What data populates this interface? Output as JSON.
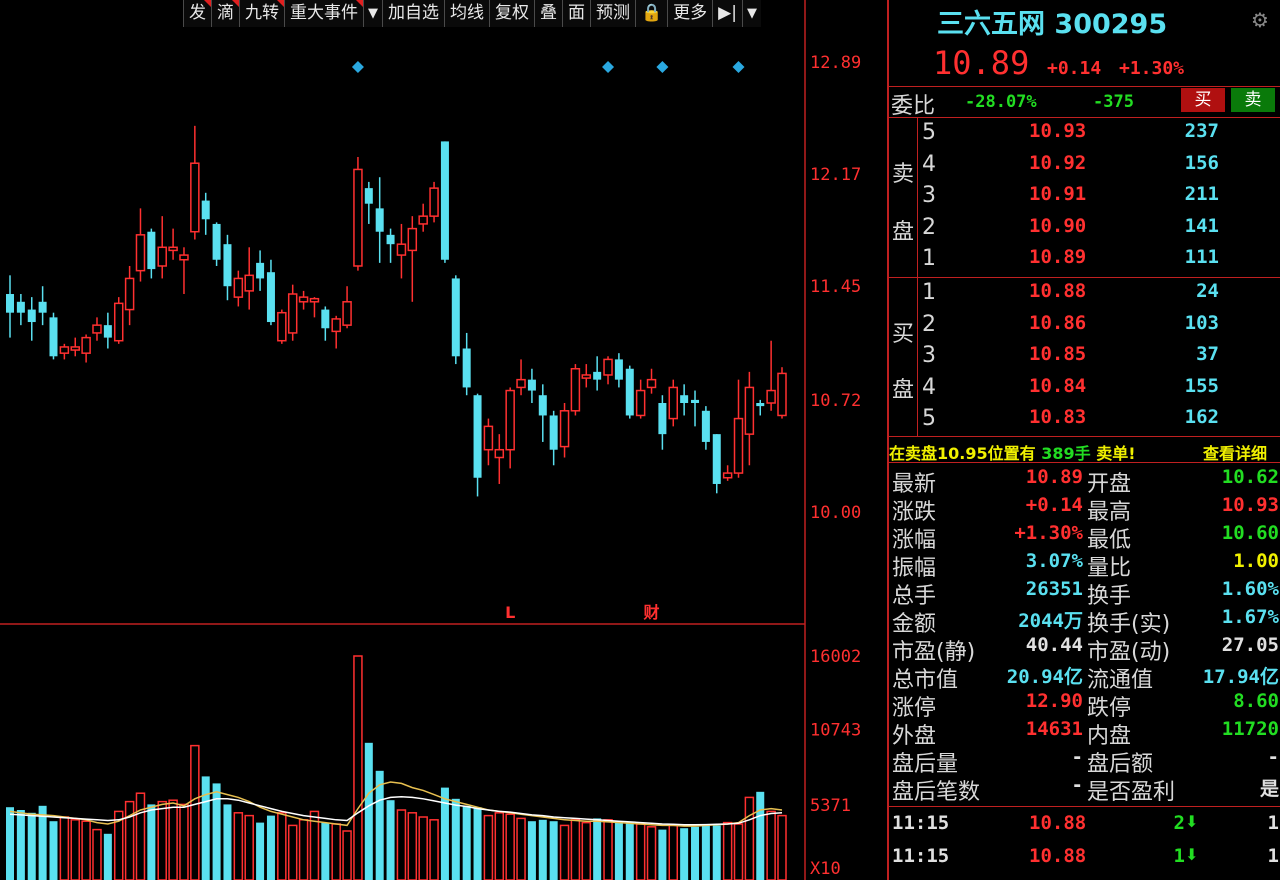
{
  "toolbar": {
    "items": [
      "发",
      "滴",
      "九转",
      "重大事件",
      "▼",
      "加自选",
      "均线",
      "复权",
      "叠",
      "面",
      "预测",
      "🔒",
      "更多",
      "▶|",
      "▼"
    ],
    "flagged": [
      0,
      1,
      2,
      3
    ]
  },
  "chart_data": [
    {
      "type": "candlestick",
      "price_ticks": [
        "12.89",
        "12.17",
        "11.45",
        "10.72",
        "10.00"
      ],
      "ylim": [
        10.0,
        12.89
      ],
      "markers_bottom": [
        "L",
        "财"
      ],
      "candles": [
        {
          "o": 11.4,
          "c": 11.28,
          "h": 11.52,
          "l": 11.12,
          "up": false
        },
        {
          "o": 11.35,
          "c": 11.28,
          "h": 11.4,
          "l": 11.2,
          "up": false
        },
        {
          "o": 11.3,
          "c": 11.22,
          "h": 11.38,
          "l": 11.1,
          "up": false
        },
        {
          "o": 11.35,
          "c": 11.28,
          "h": 11.45,
          "l": 11.2,
          "up": false
        },
        {
          "o": 11.25,
          "c": 11.0,
          "h": 11.28,
          "l": 10.98,
          "up": false
        },
        {
          "o": 11.02,
          "c": 11.06,
          "h": 11.08,
          "l": 10.98,
          "up": true
        },
        {
          "o": 11.04,
          "c": 11.06,
          "h": 11.12,
          "l": 11.0,
          "up": true
        },
        {
          "o": 11.02,
          "c": 11.12,
          "h": 11.14,
          "l": 10.96,
          "up": true
        },
        {
          "o": 11.15,
          "c": 11.2,
          "h": 11.25,
          "l": 11.1,
          "up": true
        },
        {
          "o": 11.2,
          "c": 11.12,
          "h": 11.28,
          "l": 11.05,
          "up": false
        },
        {
          "o": 11.1,
          "c": 11.34,
          "h": 11.38,
          "l": 11.08,
          "up": true
        },
        {
          "o": 11.3,
          "c": 11.5,
          "h": 11.58,
          "l": 11.2,
          "up": true
        },
        {
          "o": 11.55,
          "c": 11.78,
          "h": 11.95,
          "l": 11.48,
          "up": true
        },
        {
          "o": 11.8,
          "c": 11.56,
          "h": 11.82,
          "l": 11.5,
          "up": false
        },
        {
          "o": 11.58,
          "c": 11.7,
          "h": 11.9,
          "l": 11.5,
          "up": true
        },
        {
          "o": 11.68,
          "c": 11.7,
          "h": 11.82,
          "l": 11.62,
          "up": true
        },
        {
          "o": 11.62,
          "c": 11.65,
          "h": 11.7,
          "l": 11.4,
          "up": true
        },
        {
          "o": 11.8,
          "c": 12.24,
          "h": 12.48,
          "l": 11.75,
          "up": true
        },
        {
          "o": 12.0,
          "c": 11.88,
          "h": 12.05,
          "l": 11.78,
          "up": false
        },
        {
          "o": 11.85,
          "c": 11.62,
          "h": 11.86,
          "l": 11.58,
          "up": false
        },
        {
          "o": 11.72,
          "c": 11.45,
          "h": 11.78,
          "l": 11.36,
          "up": false
        },
        {
          "o": 11.38,
          "c": 11.5,
          "h": 11.55,
          "l": 11.32,
          "up": true
        },
        {
          "o": 11.42,
          "c": 11.52,
          "h": 11.7,
          "l": 11.3,
          "up": true
        },
        {
          "o": 11.6,
          "c": 11.5,
          "h": 11.68,
          "l": 11.42,
          "up": false
        },
        {
          "o": 11.54,
          "c": 11.22,
          "h": 11.62,
          "l": 11.2,
          "up": false
        },
        {
          "o": 11.1,
          "c": 11.28,
          "h": 11.3,
          "l": 11.08,
          "up": true
        },
        {
          "o": 11.15,
          "c": 11.4,
          "h": 11.46,
          "l": 11.1,
          "up": true
        },
        {
          "o": 11.35,
          "c": 11.38,
          "h": 11.42,
          "l": 11.3,
          "up": true
        },
        {
          "o": 11.35,
          "c": 11.37,
          "h": 11.38,
          "l": 11.25,
          "up": true
        },
        {
          "o": 11.3,
          "c": 11.18,
          "h": 11.32,
          "l": 11.1,
          "up": false
        },
        {
          "o": 11.16,
          "c": 11.24,
          "h": 11.26,
          "l": 11.05,
          "up": true
        },
        {
          "o": 11.2,
          "c": 11.35,
          "h": 11.45,
          "l": 11.18,
          "up": true
        },
        {
          "o": 11.58,
          "c": 12.2,
          "h": 12.28,
          "l": 11.55,
          "up": true
        },
        {
          "o": 12.08,
          "c": 11.98,
          "h": 12.12,
          "l": 11.85,
          "up": false
        },
        {
          "o": 11.95,
          "c": 11.8,
          "h": 12.15,
          "l": 11.6,
          "up": false
        },
        {
          "o": 11.78,
          "c": 11.72,
          "h": 11.82,
          "l": 11.6,
          "up": false
        },
        {
          "o": 11.65,
          "c": 11.72,
          "h": 11.85,
          "l": 11.5,
          "up": true
        },
        {
          "o": 11.68,
          "c": 11.82,
          "h": 11.9,
          "l": 11.35,
          "up": true
        },
        {
          "o": 11.85,
          "c": 11.9,
          "h": 11.98,
          "l": 11.8,
          "up": true
        },
        {
          "o": 11.9,
          "c": 12.08,
          "h": 12.12,
          "l": 11.86,
          "up": true
        },
        {
          "o": 12.38,
          "c": 11.62,
          "h": 12.38,
          "l": 11.6,
          "up": false
        },
        {
          "o": 11.5,
          "c": 11.0,
          "h": 11.52,
          "l": 10.95,
          "up": false
        },
        {
          "o": 11.05,
          "c": 10.8,
          "h": 11.15,
          "l": 10.75,
          "up": false
        },
        {
          "o": 10.75,
          "c": 10.22,
          "h": 10.76,
          "l": 10.1,
          "up": false
        },
        {
          "o": 10.4,
          "c": 10.55,
          "h": 10.6,
          "l": 10.3,
          "up": true
        },
        {
          "o": 10.35,
          "c": 10.4,
          "h": 10.5,
          "l": 10.18,
          "up": true
        },
        {
          "o": 10.4,
          "c": 10.78,
          "h": 10.8,
          "l": 10.28,
          "up": true
        },
        {
          "o": 10.8,
          "c": 10.85,
          "h": 10.98,
          "l": 10.75,
          "up": true
        },
        {
          "o": 10.85,
          "c": 10.78,
          "h": 10.92,
          "l": 10.7,
          "up": false
        },
        {
          "o": 10.75,
          "c": 10.62,
          "h": 10.82,
          "l": 10.45,
          "up": false
        },
        {
          "o": 10.62,
          "c": 10.4,
          "h": 10.65,
          "l": 10.3,
          "up": false
        },
        {
          "o": 10.42,
          "c": 10.65,
          "h": 10.7,
          "l": 10.35,
          "up": true
        },
        {
          "o": 10.65,
          "c": 10.92,
          "h": 10.95,
          "l": 10.62,
          "up": true
        },
        {
          "o": 10.86,
          "c": 10.88,
          "h": 10.95,
          "l": 10.8,
          "up": true
        },
        {
          "o": 10.9,
          "c": 10.85,
          "h": 11.0,
          "l": 10.78,
          "up": false
        },
        {
          "o": 10.88,
          "c": 10.98,
          "h": 11.0,
          "l": 10.82,
          "up": true
        },
        {
          "o": 10.98,
          "c": 10.85,
          "h": 11.02,
          "l": 10.8,
          "up": false
        },
        {
          "o": 10.92,
          "c": 10.62,
          "h": 10.94,
          "l": 10.6,
          "up": false
        },
        {
          "o": 10.62,
          "c": 10.78,
          "h": 10.85,
          "l": 10.6,
          "up": true
        },
        {
          "o": 10.8,
          "c": 10.85,
          "h": 10.92,
          "l": 10.76,
          "up": true
        },
        {
          "o": 10.7,
          "c": 10.5,
          "h": 10.75,
          "l": 10.4,
          "up": false
        },
        {
          "o": 10.6,
          "c": 10.8,
          "h": 10.85,
          "l": 10.55,
          "up": true
        },
        {
          "o": 10.75,
          "c": 10.7,
          "h": 10.82,
          "l": 10.62,
          "up": false
        },
        {
          "o": 10.72,
          "c": 10.7,
          "h": 10.78,
          "l": 10.55,
          "up": false
        },
        {
          "o": 10.65,
          "c": 10.45,
          "h": 10.68,
          "l": 10.4,
          "up": false
        },
        {
          "o": 10.5,
          "c": 10.18,
          "h": 10.5,
          "l": 10.12,
          "up": false
        },
        {
          "o": 10.22,
          "c": 10.25,
          "h": 10.3,
          "l": 10.2,
          "up": true
        },
        {
          "o": 10.25,
          "c": 10.6,
          "h": 10.85,
          "l": 10.22,
          "up": true
        },
        {
          "o": 10.5,
          "c": 10.8,
          "h": 10.9,
          "l": 10.3,
          "up": true
        },
        {
          "o": 10.7,
          "c": 10.68,
          "h": 10.72,
          "l": 10.62,
          "up": false
        },
        {
          "o": 10.7,
          "c": 10.78,
          "h": 11.1,
          "l": 10.65,
          "up": true
        },
        {
          "o": 10.62,
          "c": 10.89,
          "h": 10.93,
          "l": 10.6,
          "up": true
        }
      ],
      "diamond_marker_indices": [
        32,
        55,
        60,
        67
      ]
    },
    {
      "type": "bar",
      "volume_ticks": [
        "16002",
        "10743",
        "5371",
        "X10"
      ],
      "ylim": [
        0,
        16002
      ],
      "volumes": [
        5200,
        5000,
        4800,
        5300,
        4200,
        4500,
        4300,
        4200,
        3600,
        3300,
        4900,
        5600,
        6200,
        5400,
        5600,
        5700,
        5400,
        9600,
        7400,
        6900,
        5400,
        4800,
        4600,
        4100,
        4600,
        4800,
        3900,
        4300,
        4900,
        4100,
        4000,
        3500,
        16002,
        9800,
        7800,
        5700,
        5000,
        4800,
        4500,
        4300,
        6600,
        5800,
        5300,
        5200,
        4600,
        4800,
        4700,
        4400,
        4200,
        4300,
        4200,
        3900,
        4300,
        4100,
        4400,
        4300,
        4200,
        4100,
        4000,
        3800,
        3600,
        3900,
        3700,
        3800,
        3900,
        3900,
        4100,
        4000,
        5900,
        6300,
        4900,
        4600
      ],
      "ma_lines": [
        {
          "color": "#e8c050",
          "values": [
            4900,
            4800,
            4700,
            4650,
            4600,
            4500,
            4400,
            4300,
            4100,
            4000,
            4200,
            4600,
            5000,
            5200,
            5400,
            5500,
            5300,
            5800,
            6100,
            6300,
            6100,
            5900,
            5600,
            5200,
            4900,
            4700,
            4500,
            4300,
            4200,
            4100,
            4000,
            3900,
            5100,
            6200,
            6800,
            7000,
            6900,
            6600,
            6400,
            6100,
            5800,
            5600,
            5400,
            5200,
            5000,
            4900,
            4800,
            4700,
            4600,
            4500,
            4400,
            4300,
            4250,
            4200,
            4200,
            4150,
            4100,
            4050,
            4000,
            3950,
            3900,
            3900,
            3850,
            3850,
            3900,
            3950,
            4000,
            4100,
            4600,
            5000,
            5100,
            5000
          ]
        },
        {
          "color": "#ffffff",
          "values": [
            4700,
            4650,
            4600,
            4550,
            4500,
            4450,
            4400,
            4350,
            4300,
            4250,
            4300,
            4500,
            4800,
            5000,
            5100,
            5200,
            5200,
            5400,
            5600,
            5800,
            5800,
            5700,
            5500,
            5300,
            5100,
            4900,
            4750,
            4600,
            4500,
            4400,
            4300,
            4250,
            4800,
            5300,
            5700,
            5900,
            5950,
            5900,
            5800,
            5650,
            5500,
            5350,
            5250,
            5100,
            5000,
            4900,
            4850,
            4750,
            4650,
            4600,
            4500,
            4450,
            4400,
            4350,
            4300,
            4250,
            4200,
            4150,
            4100,
            4050,
            4000,
            3980,
            3950,
            3950,
            3960,
            3980,
            4000,
            4050,
            4300,
            4600,
            4750,
            4800
          ]
        }
      ]
    }
  ],
  "panel": {
    "stock_name": "三六五网",
    "stock_code": "300295",
    "price": "10.89",
    "change": "+0.14",
    "change_pct": "+1.30%",
    "ratio_label": "委比",
    "ratio_pct": "-28.07%",
    "ratio_val": "-375",
    "buy_btn": "买",
    "sell_btn": "卖",
    "sell_side_label": [
      "卖",
      "盘"
    ],
    "buy_side_label": [
      "买",
      "盘"
    ],
    "sell_levels": [
      {
        "n": "5",
        "p": "10.93",
        "v": "237"
      },
      {
        "n": "4",
        "p": "10.92",
        "v": "156"
      },
      {
        "n": "3",
        "p": "10.91",
        "v": "211"
      },
      {
        "n": "2",
        "p": "10.90",
        "v": "141"
      },
      {
        "n": "1",
        "p": "10.89",
        "v": "111"
      }
    ],
    "buy_levels": [
      {
        "n": "1",
        "p": "10.88",
        "v": "24"
      },
      {
        "n": "2",
        "p": "10.86",
        "v": "103"
      },
      {
        "n": "3",
        "p": "10.85",
        "v": "37"
      },
      {
        "n": "4",
        "p": "10.84",
        "v": "155"
      },
      {
        "n": "5",
        "p": "10.83",
        "v": "162"
      }
    ],
    "notice_a": "在卖盘10.95位置有",
    "notice_b": "389手",
    "notice_c": "卖单!",
    "notice_link": "查看详细",
    "stats": [
      {
        "l": "最新",
        "v": "10.89",
        "vc": "red",
        "l2": "开盘",
        "v2": "10.62",
        "vc2": "green"
      },
      {
        "l": "涨跌",
        "v": "+0.14",
        "vc": "red",
        "l2": "最高",
        "v2": "10.93",
        "vc2": "red"
      },
      {
        "l": "涨幅",
        "v": "+1.30%",
        "vc": "red",
        "l2": "最低",
        "v2": "10.60",
        "vc2": "green"
      },
      {
        "l": "振幅",
        "v": "3.07%",
        "vc": "cyan",
        "l2": "量比",
        "v2": "1.00",
        "vc2": "yellow"
      },
      {
        "l": "总手",
        "v": "26351",
        "vc": "cyan",
        "l2": "换手",
        "v2": "1.60%",
        "vc2": "cyan"
      },
      {
        "l": "金额",
        "v": "2044万",
        "vc": "cyan",
        "l2": "换手(实)",
        "v2": "1.67%",
        "vc2": "cyan"
      },
      {
        "l": "市盈(静)",
        "v": "40.44",
        "vc": "white",
        "l2": "市盈(动)",
        "v2": "27.05",
        "vc2": "white"
      },
      {
        "l": "总市值",
        "v": "20.94亿",
        "vc": "cyan",
        "l2": "流通值",
        "v2": "17.94亿",
        "vc2": "cyan"
      },
      {
        "l": "涨停",
        "v": "12.90",
        "vc": "red",
        "l2": "跌停",
        "v2": "8.60",
        "vc2": "green"
      },
      {
        "l": "外盘",
        "v": "14631",
        "vc": "red",
        "l2": "内盘",
        "v2": "11720",
        "vc2": "green"
      },
      {
        "l": "盘后量",
        "v": "-",
        "vc": "white",
        "l2": "盘后额",
        "v2": "-",
        "vc2": "white"
      },
      {
        "l": "盘后笔数",
        "v": "-",
        "vc": "white",
        "l2": "是否盈利",
        "v2": "是",
        "vc2": "white"
      }
    ],
    "ticks": [
      {
        "t": "11:15",
        "p": "10.88",
        "v": "2",
        "n": "1"
      },
      {
        "t": "11:15",
        "p": "10.88",
        "v": "1",
        "n": "1"
      }
    ]
  }
}
